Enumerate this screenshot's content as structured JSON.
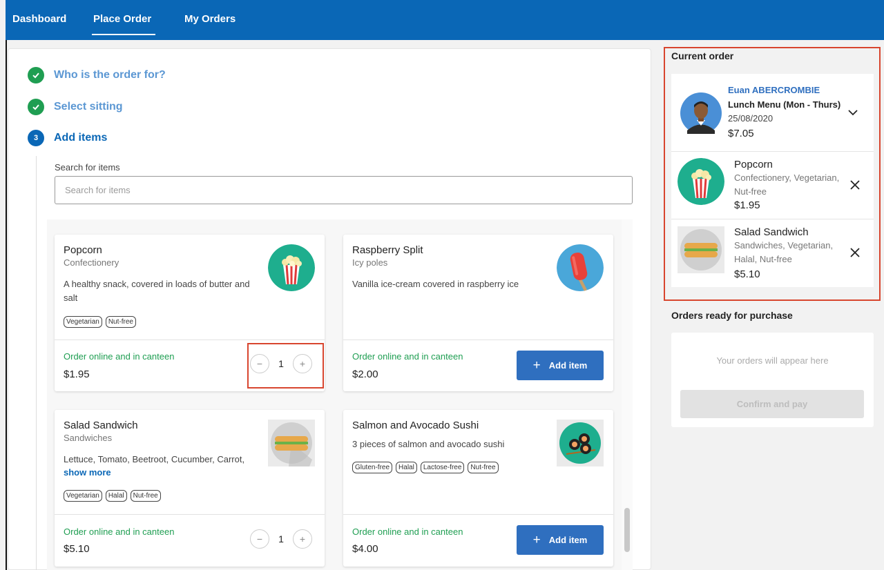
{
  "nav": {
    "items": [
      {
        "label": "Dashboard"
      },
      {
        "label": "Place Order"
      },
      {
        "label": "My Orders"
      }
    ],
    "active": "Place Order"
  },
  "steps": [
    {
      "label": "Who is the order for?",
      "state": "done"
    },
    {
      "label": "Select sitting",
      "state": "done"
    },
    {
      "label": "Add items",
      "state": "current",
      "number": "3"
    }
  ],
  "search": {
    "label": "Search for items",
    "placeholder": "Search for items",
    "value": ""
  },
  "items": [
    {
      "name": "Popcorn",
      "category": "Confectionery",
      "description": "A healthy snack, covered in loads of butter and salt",
      "tags": [
        "Vegetarian",
        "Nut-free"
      ],
      "availability": "Order online and in canteen",
      "price": "$1.95",
      "quantity": "1",
      "icon": "popcorn-icon"
    },
    {
      "name": "Raspberry Split",
      "category": "Icy poles",
      "description": "Vanilla ice-cream covered in raspberry ice",
      "tags": [],
      "availability": "Order online and in canteen",
      "price": "$2.00",
      "button": "Add item",
      "icon": "icepole-icon"
    },
    {
      "name": "Salad Sandwich",
      "category": "Sandwiches",
      "description": "Lettuce, Tomato, Beetroot, Cucumber, Carrot,",
      "show_more": "show more",
      "tags": [
        "Vegetarian",
        "Halal",
        "Nut-free"
      ],
      "availability": "Order online and in canteen",
      "price": "$5.10",
      "quantity": "1",
      "icon": "sandwich-icon"
    },
    {
      "name": "Salmon and Avocado Sushi",
      "category": "",
      "description": "3 pieces of salmon and avocado sushi",
      "tags": [
        "Gluten-free",
        "Halal",
        "Lactose-free",
        "Nut-free"
      ],
      "availability": "Order online and in canteen",
      "price": "$4.00",
      "button": "Add item",
      "icon": "sushi-icon"
    }
  ],
  "current_order": {
    "title": "Current order",
    "customer": "Euan ABERCROMBIE",
    "menu": "Lunch Menu (Mon - Thurs)",
    "date": "25/08/2020",
    "total": "$7.05",
    "items": [
      {
        "name": "Popcorn",
        "categories": "Confectionery, Vegetarian, Nut-free",
        "price": "$1.95"
      },
      {
        "name": "Salad Sandwich",
        "categories": "Sandwiches, Vegetarian, Halal, Nut-free",
        "price": "$5.10"
      }
    ]
  },
  "ready": {
    "title": "Orders ready for purchase",
    "empty_text": "Your orders will appear here",
    "button": "Confirm and pay"
  },
  "colors": {
    "brand_blue": "#0a67b6",
    "success_green": "#1f9e52",
    "highlight_red": "#d8452e"
  }
}
